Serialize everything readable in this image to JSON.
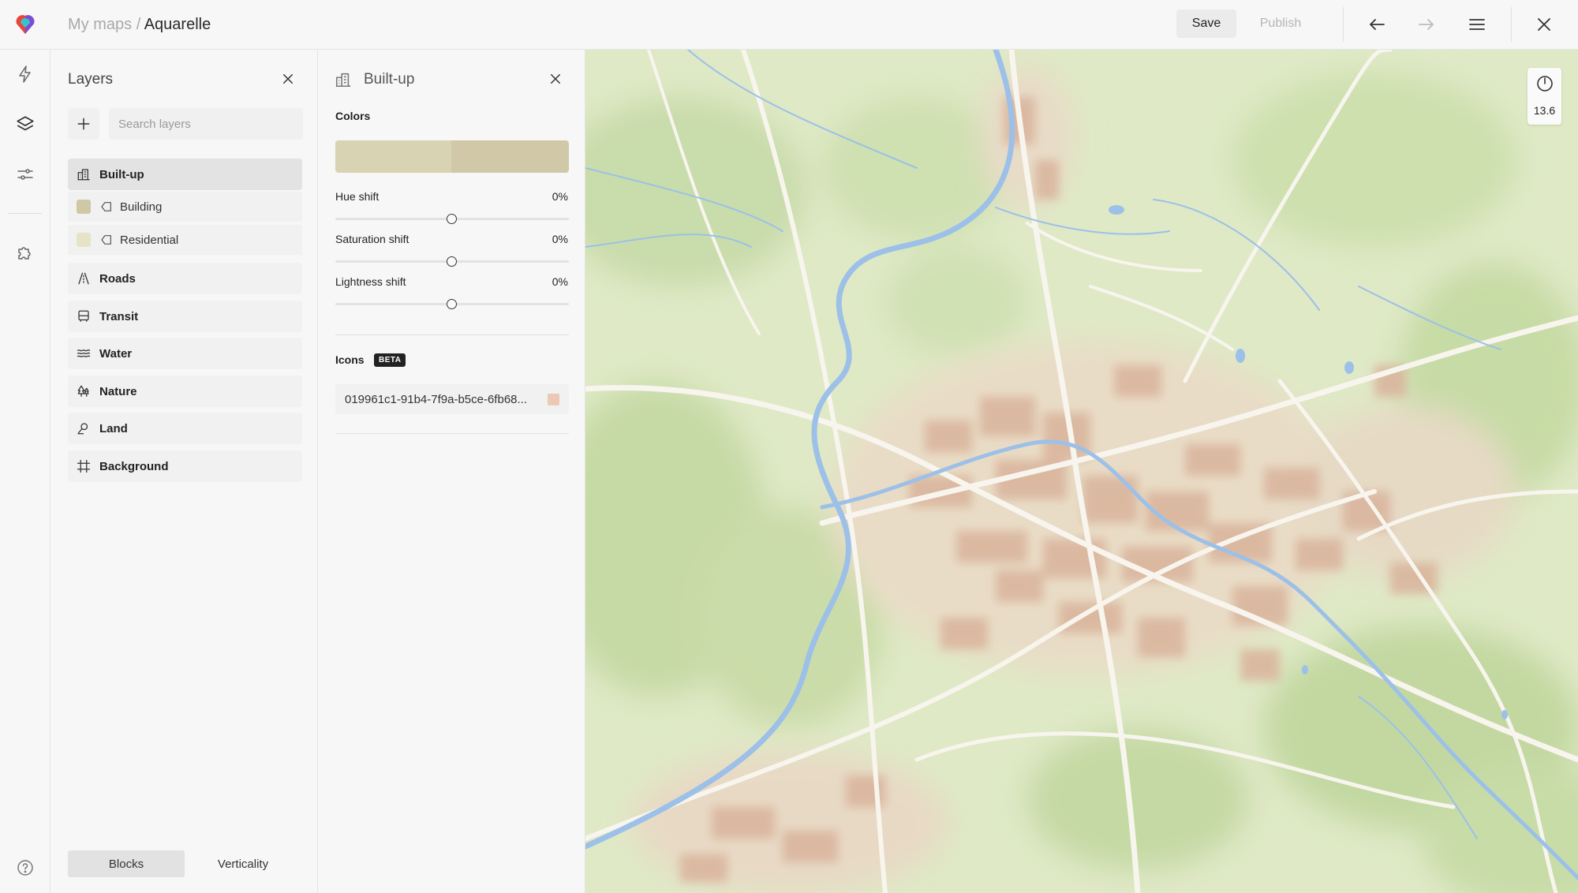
{
  "header": {
    "breadcrumb_root": "My maps",
    "breadcrumb_sep": "/",
    "breadcrumb_current": "Aquarelle",
    "save_label": "Save",
    "publish_label": "Publish",
    "icons": [
      "logo-icon",
      "undo-arrow-icon",
      "redo-arrow-icon",
      "menu-icon",
      "close-icon"
    ]
  },
  "rail": {
    "items": [
      "bolt-icon",
      "layers-icon",
      "sliders-icon",
      "puzzle-icon"
    ],
    "bottom": "help-icon"
  },
  "layers_panel": {
    "title": "Layers",
    "search_placeholder": "Search layers",
    "groups": [
      {
        "label": "Built-up",
        "icon": "buildings-icon",
        "active": true
      },
      {
        "label": "Roads",
        "icon": "road-icon"
      },
      {
        "label": "Transit",
        "icon": "bus-icon"
      },
      {
        "label": "Water",
        "icon": "waves-icon"
      },
      {
        "label": "Nature",
        "icon": "trees-icon"
      },
      {
        "label": "Land",
        "icon": "pin-icon"
      },
      {
        "label": "Background",
        "icon": "grid-frame-icon"
      }
    ],
    "sublayers": [
      {
        "label": "Building",
        "color": "#cfc8a6",
        "icon": "fill-tag-icon"
      },
      {
        "label": "Residential",
        "color": "#e6e3c7",
        "icon": "fill-tag-icon"
      }
    ],
    "modes": [
      "Blocks",
      "Verticality"
    ],
    "active_mode": "Blocks"
  },
  "detail_panel": {
    "title": "Built-up",
    "colors_label": "Colors",
    "palette": [
      "#d8d3b2",
      "#d0c8a6"
    ],
    "sliders": [
      {
        "label": "Hue shift",
        "value": "0%",
        "fraction": 0.5
      },
      {
        "label": "Saturation shift",
        "value": "0%",
        "fraction": 0.5
      },
      {
        "label": "Lightness shift",
        "value": "0%",
        "fraction": 0.5
      }
    ],
    "icons_label": "Icons",
    "beta_badge": "BETA",
    "icon_id": "019961c1-91b4-7f9a-b5ce-6fb68...",
    "icon_color": "#ecc9b4"
  },
  "map": {
    "zoom_level": "13.6",
    "colors": {
      "base": "#dce9c2",
      "forest": "#c6dca7",
      "water": "#9cc0e8",
      "buildings": "#dcb69f",
      "roads": "#f7f3ec"
    }
  }
}
